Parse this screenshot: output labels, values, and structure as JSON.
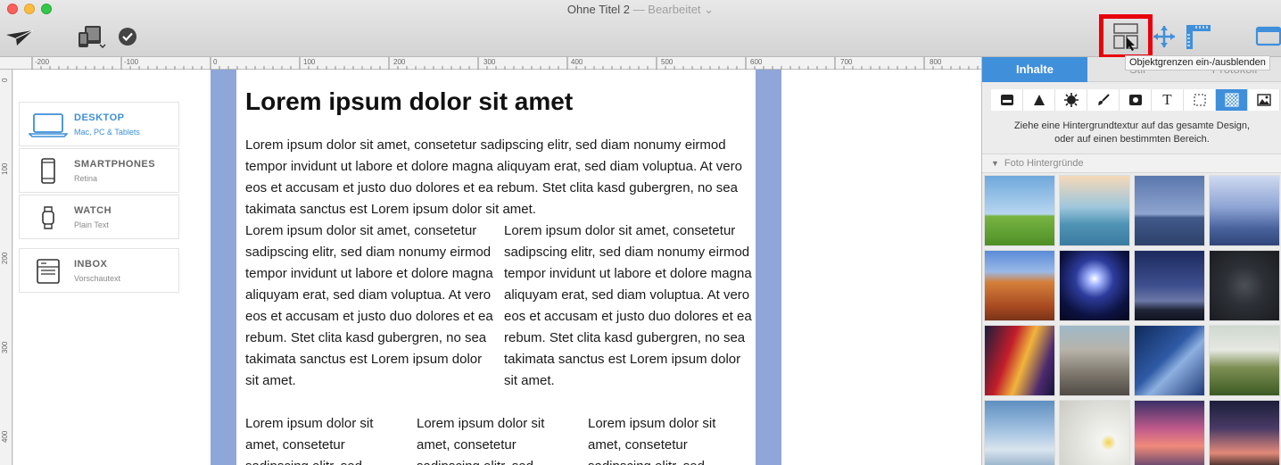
{
  "window": {
    "title": "Ohne Titel 2",
    "separator": "—",
    "state": "Bearbeitet",
    "state_chevron": "⌄"
  },
  "toolbar": {
    "tooltip": "Objektgrenzen ein-/ausblenden"
  },
  "rulers": {
    "top": [
      "-200",
      "-100",
      "0",
      "100",
      "200",
      "300",
      "400",
      "500",
      "600",
      "700",
      "800"
    ],
    "left": [
      "0",
      "100",
      "200",
      "300",
      "400"
    ]
  },
  "devices": [
    {
      "title": "DESKTOP",
      "subtitle": "Mac, PC & Tablets",
      "active": true
    },
    {
      "title": "SMARTPHONES",
      "subtitle": "Retina",
      "active": false
    },
    {
      "title": "WATCH",
      "subtitle": "Plain Text",
      "active": false
    },
    {
      "title": "INBOX",
      "subtitle": "Vorschautext",
      "active": false
    }
  ],
  "content": {
    "heading": "Lorem ipsum dolor sit amet",
    "paragraph": "Lorem ipsum dolor sit amet, consetetur sadipscing elitr, sed diam nonumy eirmod tempor invidunt ut labore et dolore magna aliquyam erat, sed diam voluptua. At vero eos et accusam et justo duo dolores et ea rebum. Stet clita kasd gubergren, no sea takimata sanctus est Lorem ipsum dolor sit amet.",
    "col2_left": "Lorem ipsum dolor sit amet, consetetur sadipscing elitr, sed diam nonumy eirmod tempor invidunt ut labore et dolore magna aliquyam erat, sed diam voluptua. At vero eos et accusam et justo duo dolores et ea rebum. Stet clita kasd gubergren, no sea takimata sanctus est Lorem ipsum dolor sit amet.",
    "col2_right": "Lorem ipsum dolor sit amet, consetetur sadipscing elitr, sed diam nonumy eirmod tempor invidunt ut labore et dolore magna aliquyam erat, sed diam voluptua. At vero eos et accusam et justo duo dolores et ea rebum. Stet clita kasd gubergren, no sea takimata sanctus est Lorem ipsum dolor sit amet.",
    "col3_a": "Lorem ipsum dolor sit amet, consetetur sadipscing elitr, sed",
    "col3_b": "Lorem ipsum dolor sit amet, consetetur sadipscing elitr, sed",
    "col3_c": "Lorem ipsum dolor sit amet, consetetur sadipscing elitr, sed"
  },
  "panel": {
    "tabs": [
      "Inhalte",
      "Stil",
      "Protokoll"
    ],
    "hint_line1": "Ziehe eine Hintergrundtextur auf das gesamte Design,",
    "hint_line2": "oder auf einen bestimmten Bereich.",
    "section_title": "Foto Hintergründe",
    "tools": [
      "box-icon",
      "triangle-icon",
      "badge-icon",
      "brush-icon",
      "video-icon",
      "text-icon",
      "selection-icon",
      "texture-icon",
      "image-icon"
    ],
    "selected_tool": "texture-icon"
  },
  "colors": {
    "accent": "#3f8fdb",
    "page_frame": "#8fa6d8",
    "highlight_box": "#e8000b"
  }
}
